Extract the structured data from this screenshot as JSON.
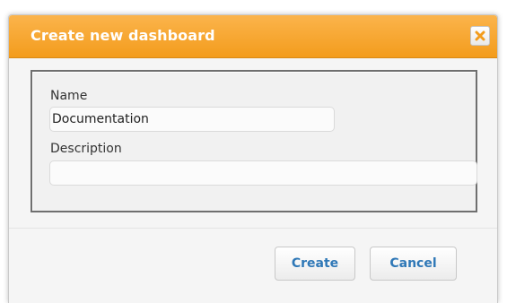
{
  "dialog": {
    "title": "Create new dashboard",
    "close_icon": "close-icon",
    "accent_color": "#f4a32b"
  },
  "form": {
    "name_label": "Name",
    "name_value": "Documentation",
    "description_label": "Description",
    "description_value": ""
  },
  "actions": {
    "create_label": "Create",
    "cancel_label": "Cancel",
    "button_text_color": "#2f78b7"
  }
}
